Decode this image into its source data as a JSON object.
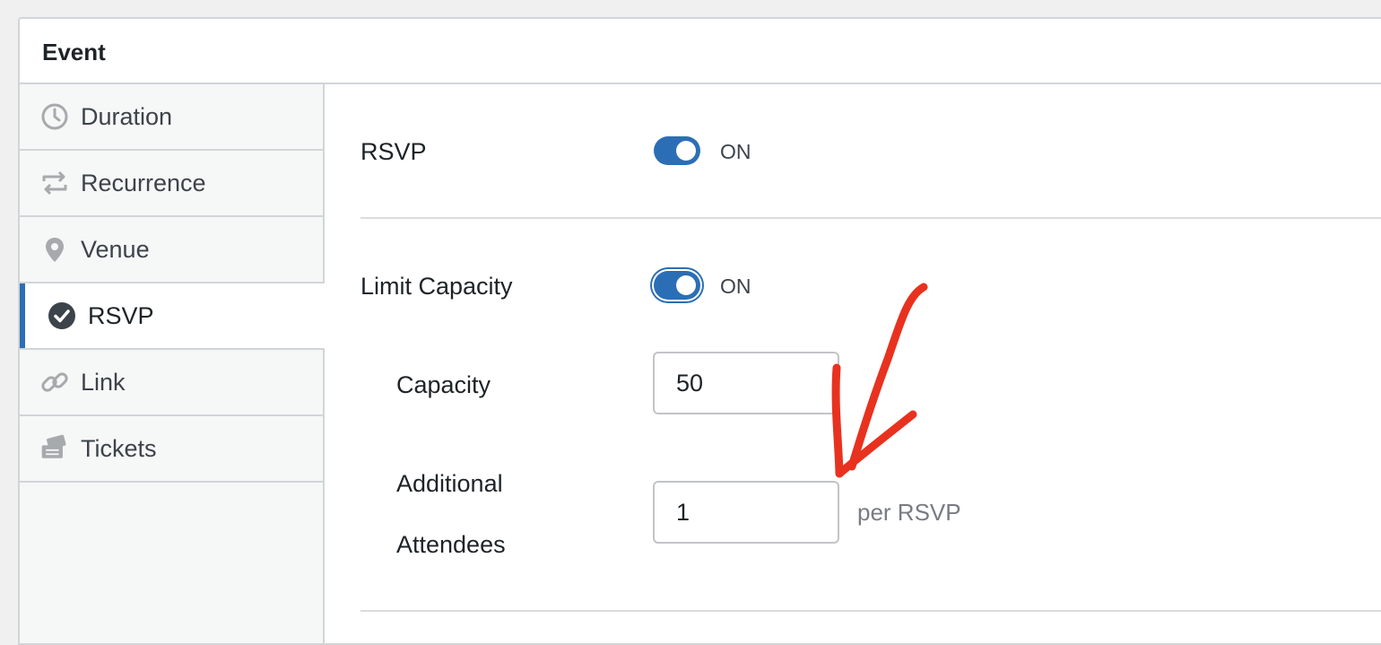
{
  "panel": {
    "title": "Event"
  },
  "tabs": [
    {
      "label": "Duration",
      "icon": "clock-icon"
    },
    {
      "label": "Recurrence",
      "icon": "repeat-icon"
    },
    {
      "label": "Venue",
      "icon": "location-pin-icon"
    },
    {
      "label": "RSVP",
      "icon": "check-circle-icon",
      "active": true
    },
    {
      "label": "Link",
      "icon": "link-icon"
    },
    {
      "label": "Tickets",
      "icon": "tickets-icon"
    }
  ],
  "rsvp": {
    "label": "RSVP",
    "toggle_state": "ON"
  },
  "limit_capacity": {
    "label": "Limit Capacity",
    "toggle_state": "ON"
  },
  "capacity": {
    "label": "Capacity",
    "value": "50"
  },
  "additional_attendees": {
    "label_line1": "Additional",
    "label_line2": "Attendees",
    "value": "1",
    "suffix": "per RSVP"
  },
  "colors": {
    "accent": "#2c6eb5",
    "annotation": "#e8321f"
  }
}
